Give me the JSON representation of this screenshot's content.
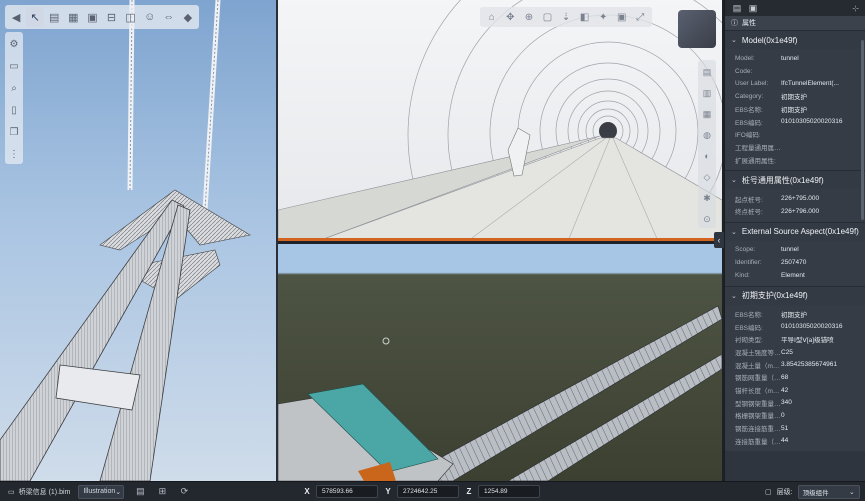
{
  "left_toolbar": {
    "icons": [
      "back-icon",
      "cursor-icon",
      "layers-icon",
      "grid-icon",
      "box-icon",
      "measure-icon",
      "section-icon",
      "person-icon",
      "link-icon",
      "eraser-icon"
    ]
  },
  "left_vertical_toolbar": {
    "icons": [
      "gear-icon",
      "folder-icon",
      "search-icon",
      "document-icon",
      "copy-icon",
      "ruler-icon"
    ]
  },
  "top_right_toolbar": {
    "icons": [
      "home-icon",
      "orbit-icon",
      "zoom-icon",
      "fit-icon",
      "walk-icon",
      "section-box-icon",
      "light-icon",
      "camera-icon",
      "fullscreen-icon"
    ]
  },
  "nav_cube": {
    "label": ""
  },
  "properties_panel": {
    "tab_label": "属性",
    "sections": [
      {
        "title": "Model(0x1e49f)",
        "rows": [
          {
            "key": "Model:",
            "value": "tunnel"
          },
          {
            "key": "Code:",
            "value": ""
          },
          {
            "key": "User Label:",
            "value": "IfcTunnelElement(..."
          },
          {
            "key": "Category:",
            "value": "初期支护"
          },
          {
            "key": "EBS名称:",
            "value": "初期支护"
          },
          {
            "key": "EBS编码:",
            "value": "01010305020020316"
          },
          {
            "key": "IFO编码:",
            "value": ""
          },
          {
            "key": "工程量通用属性:",
            "value": ""
          },
          {
            "key": "扩展通用属性:",
            "value": ""
          }
        ]
      },
      {
        "title": "桩号通用属性(0x1e49f)",
        "rows": [
          {
            "key": "起点桩号:",
            "value": "226+795.000"
          },
          {
            "key": "终点桩号:",
            "value": "226+796.000"
          }
        ]
      },
      {
        "title": "External Source Aspect(0x1e49f)",
        "rows": [
          {
            "key": "Scope:",
            "value": "tunnel"
          },
          {
            "key": "Identifier:",
            "value": "2507470"
          },
          {
            "key": "Kind:",
            "value": "Element"
          }
        ]
      },
      {
        "title": "初期支护(0x1e49f)",
        "rows": [
          {
            "key": "EBS名称:",
            "value": "初期支护"
          },
          {
            "key": "EBS编码:",
            "value": "01010305020020316"
          },
          {
            "key": "衬砌类型:",
            "value": "平导Ⅰ型Ⅴ[a]级锚喷"
          },
          {
            "key": "混凝土强度等级:",
            "value": "C25"
          },
          {
            "key": "混凝土量（m3）:",
            "value": "3.85425385674961"
          },
          {
            "key": "钢筋网重量（k...:",
            "value": "68"
          },
          {
            "key": "锚杆长度（m）:",
            "value": "42"
          },
          {
            "key": "型钢钢架重量...:",
            "value": "340"
          },
          {
            "key": "格栅钢架重量...:",
            "value": "0"
          },
          {
            "key": "钢筋连接筋重量...:",
            "value": "51"
          },
          {
            "key": "连接筋重量（k...:",
            "value": "44"
          }
        ]
      }
    ]
  },
  "status_bar": {
    "file_name": "桥梁信息 (1).bim",
    "render_mode": "Illustration",
    "x_label": "X",
    "x_value": "578593.66",
    "y_label": "Y",
    "y_value": "2724642.25",
    "z_label": "Z",
    "z_value": "1254.89",
    "layer_label": "层级:",
    "layer_value": "顶级组件"
  }
}
